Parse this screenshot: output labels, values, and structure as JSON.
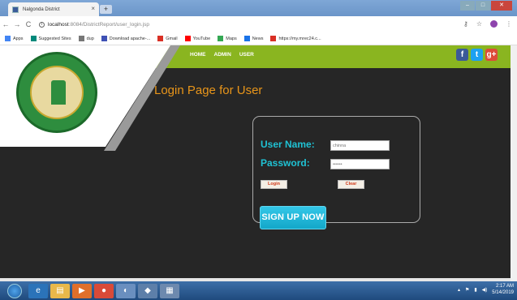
{
  "browser": {
    "tab_title": "Nalgonda District",
    "tab_close": "×",
    "new_tab": "+",
    "url_host": "localhost",
    "url_path": ":8084/DistrictReport/user_login.jsp",
    "back": "←",
    "forward": "→",
    "reload": "C",
    "bookmarks": [
      {
        "label": "Apps",
        "icon": "apps-icon",
        "color": "#4285f4"
      },
      {
        "label": "Suggested Sites",
        "icon": "bing-icon",
        "color": "#00897b"
      },
      {
        "label": "dup",
        "icon": "page-icon",
        "color": "#777777"
      },
      {
        "label": "Download apache-...",
        "icon": "download-icon",
        "color": "#3f51b5"
      },
      {
        "label": "Gmail",
        "icon": "gmail-icon",
        "color": "#d93025"
      },
      {
        "label": "YouTube",
        "icon": "youtube-icon",
        "color": "#ff0000"
      },
      {
        "label": "Maps",
        "icon": "maps-icon",
        "color": "#34a853"
      },
      {
        "label": "News",
        "icon": "news-icon",
        "color": "#1a73e8"
      },
      {
        "label": "https://my.mrec24.c...",
        "icon": "gmail-icon",
        "color": "#d93025"
      }
    ]
  },
  "site": {
    "seal_text": "GOVERNMENT OF TELANGANA",
    "menu": [
      "HOME",
      "ADMIN",
      "USER"
    ],
    "social": [
      "f",
      "t",
      "g+"
    ],
    "title": "Login Page for User"
  },
  "login": {
    "username_label": "User Name:",
    "username_value": "chinna",
    "password_label": "Password:",
    "password_value": "••••••",
    "login_button": "Login",
    "clear_button": "Clear",
    "signup_button": "SIGN UP NOW"
  },
  "taskbar": {
    "time": "2:17 AM",
    "date": "5/14/2019"
  },
  "colors": {
    "accent_green": "#8ab520",
    "title_orange": "#e8951a",
    "label_cyan": "#1fc2d4"
  }
}
